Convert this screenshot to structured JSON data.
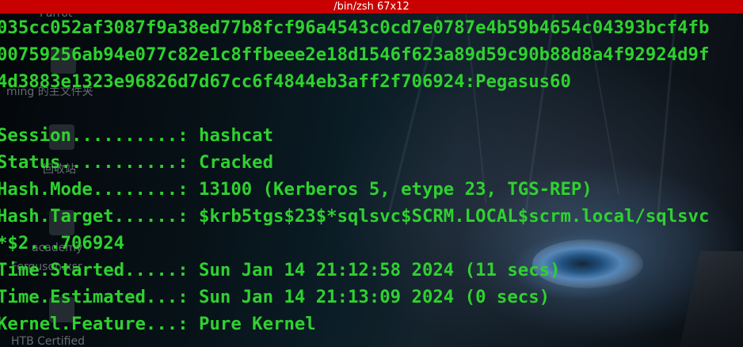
{
  "window": {
    "title": "/bin/zsh 67x12"
  },
  "terminal": {
    "lines": [
      "035cc052af3087f9a38ed77b8fcf96a4543c0cd7e0787e4b59b4654c04393bcf4fb",
      "00759256ab94e077c82e1c8ffbeee2e18d1546f623a89d59c90b88d8a4f92924d9f",
      "4d3883e1323e96826d7d67cc6f4844eb3aff2f706924:Pegasus60",
      "",
      "Session..........: hashcat",
      "Status...........: Cracked",
      "Hash.Mode........: 13100 (Kerberos 5, etype 23, TGS-REP)",
      "Hash.Target......: $krb5tgs$23$*sqlsvc$SCRM.LOCAL$scrm.local/sqlsvc",
      "*$2...706924",
      "Time.Started.....: Sun Jan 14 21:12:58 2024 (11 secs)",
      "Time.Estimated...: Sun Jan 14 21:13:09 2024 (0 secs)",
      "Kernel.Feature...: Pure Kernel"
    ],
    "text_color": "#2fd12f"
  },
  "desktop": {
    "icons": [
      {
        "label": "Parrot",
        "icon": "parrot-icon"
      },
      {
        "label": "ming 的主文件夹",
        "icon": "home-folder-icon"
      },
      {
        "label": "回收站",
        "icon": "trash-icon"
      },
      {
        "label": "academy",
        "icon": "file-icon"
      },
      {
        "label": "Ferguson.xsr",
        "icon": "file-icon"
      },
      {
        "label": "HTB Certified",
        "icon": "file-icon"
      }
    ]
  },
  "colors": {
    "titlebar": "#c80000",
    "titlebar_text": "#ffffff"
  }
}
